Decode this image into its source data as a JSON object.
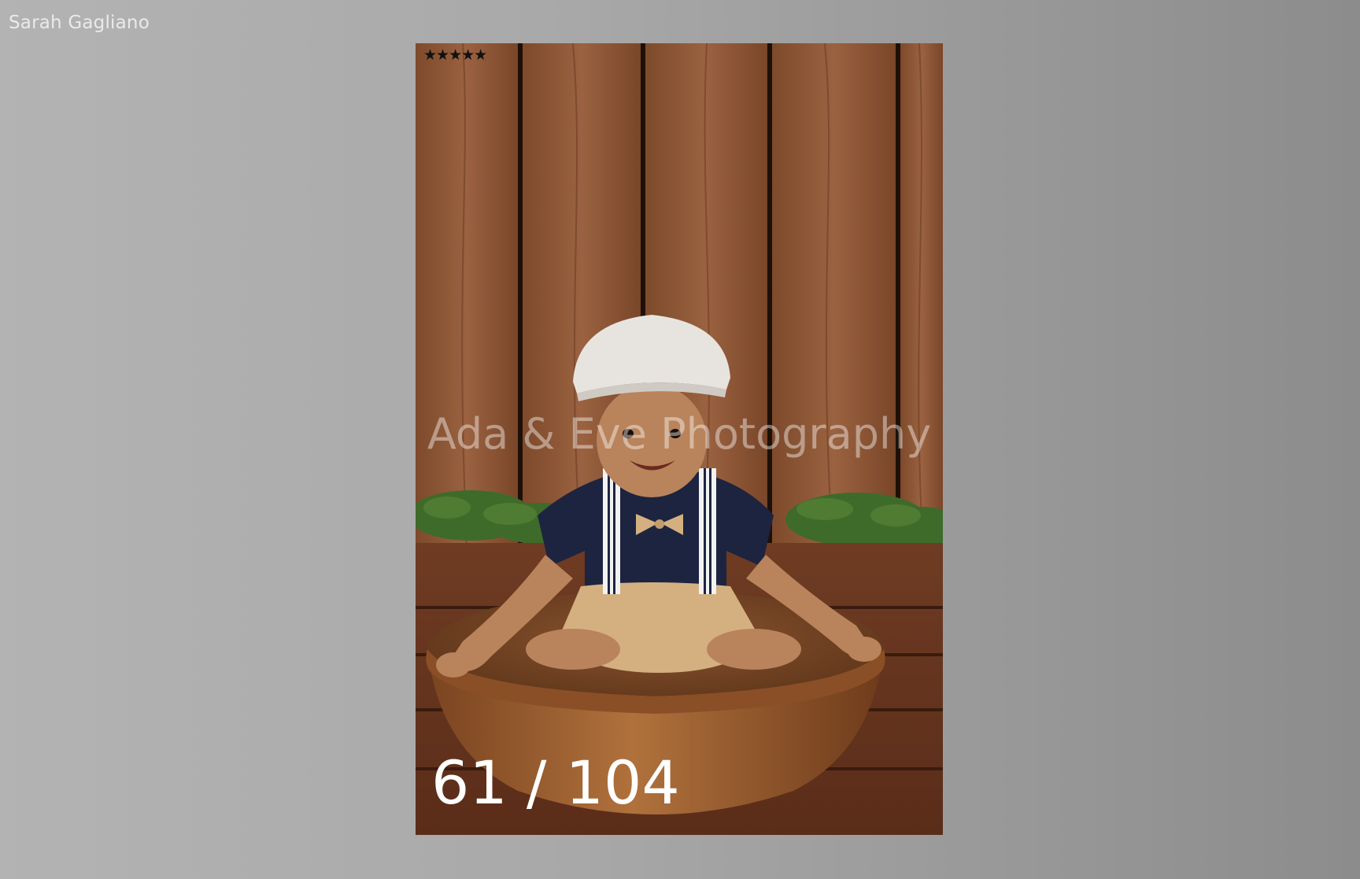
{
  "viewer": {
    "client_name": "Sarah Gagliano"
  },
  "photo": {
    "rating_stars": "★★★★★",
    "rating_value": 5,
    "rating_max": 5,
    "watermark": "Ada & Eve Photography",
    "counter": "61 / 104",
    "current_index": 61,
    "total": 104
  },
  "colors": {
    "background": "#a8a8a8",
    "wood_wall": "#8a5634",
    "wood_floor": "#6b3a22",
    "bowl": "#9a5a2c"
  }
}
